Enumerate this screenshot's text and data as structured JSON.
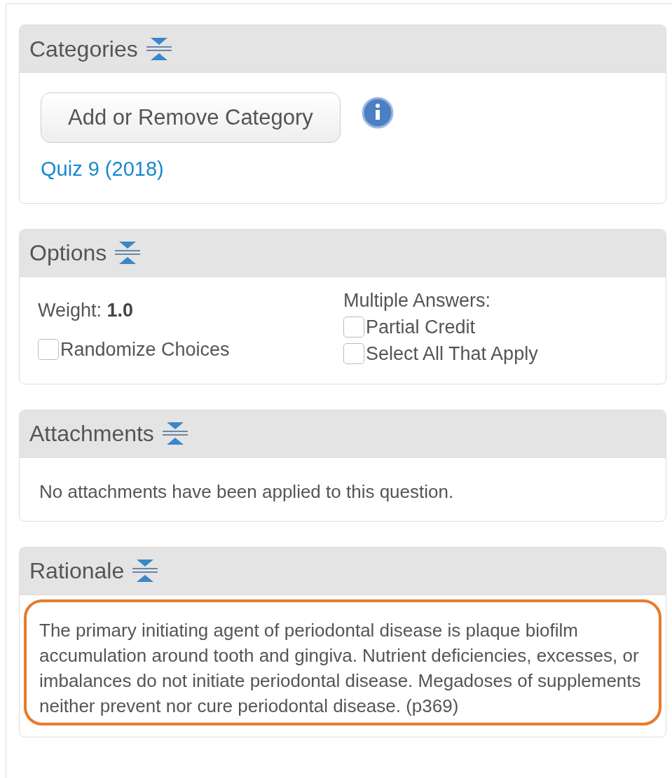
{
  "panels": [
    {
      "kind": "categories",
      "title": "Categories",
      "button": "Add or Remove Category",
      "link": "Quiz 9 (2018)"
    },
    {
      "kind": "options",
      "title": "Options",
      "weight_label": "Weight:",
      "weight_value": "1.0",
      "left_checks": [
        {
          "label": "Randomize Choices",
          "checked": false
        }
      ],
      "multiple_label": "Multiple Answers:",
      "right_checks": [
        {
          "label": "Partial Credit",
          "checked": false
        },
        {
          "label": "Select All That Apply",
          "checked": false
        }
      ]
    },
    {
      "kind": "text",
      "title": "Attachments",
      "text": "No attachments have been applied to this question."
    },
    {
      "kind": "text",
      "title": "Rationale",
      "text": "The primary initiating agent of periodontal disease is plaque biofilm accumulation around tooth and gingiva. Nutrient deficiencies, excesses, or imbalances do not initiate periodontal disease. Megadoses of supplements neither prevent nor cure periodontal disease. (p369)",
      "highlighted": true
    }
  ]
}
